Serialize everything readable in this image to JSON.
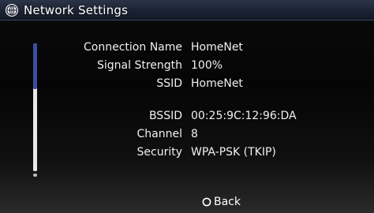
{
  "header": {
    "title": "Network Settings",
    "icon": "globe-network-icon"
  },
  "settings": [
    {
      "label": "Connection Name",
      "value": "HomeNet"
    },
    {
      "label": "Signal Strength",
      "value": "100%"
    },
    {
      "label": "SSID",
      "value": "HomeNet"
    },
    {
      "label": "BSSID",
      "value": "00:25:9C:12:96:DA"
    },
    {
      "label": "Channel",
      "value": "8"
    },
    {
      "label": "Security",
      "value": "WPA-PSK (TKIP)"
    }
  ],
  "footer": {
    "back_label": "Back",
    "back_icon": "circle-button-icon"
  },
  "colors": {
    "header_bg": "#1b2232",
    "scroll_thumb": "#3b4ea0",
    "scroll_track": "#e8e8e8"
  }
}
